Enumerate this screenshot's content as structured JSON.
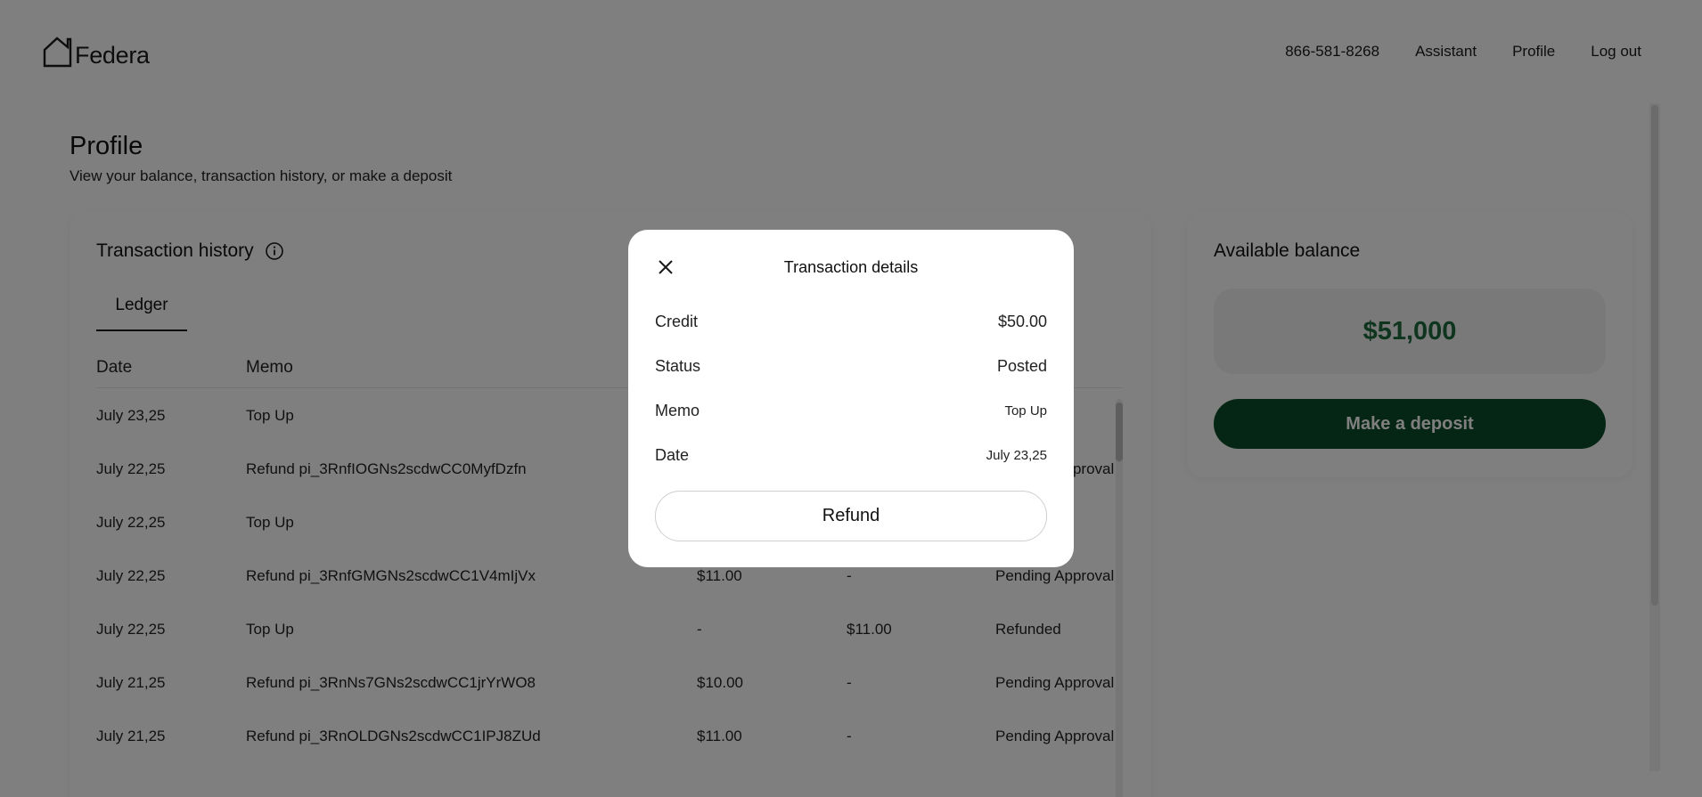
{
  "header": {
    "logo_text": "Federa",
    "nav": [
      "866-581-8268",
      "Assistant",
      "Profile",
      "Log out"
    ]
  },
  "page": {
    "title": "Profile",
    "subtitle": "View your balance, transaction history, or make a deposit"
  },
  "transactions": {
    "title": "Transaction history",
    "tab": "Ledger",
    "columns": [
      "Date",
      "Memo"
    ],
    "rows": [
      {
        "date": "July 23,25",
        "memo": "Top Up",
        "debit": "",
        "credit": "",
        "status": ""
      },
      {
        "date": "July 22,25",
        "memo": "Refund pi_3RnfIOGNs2scdwCC0MyfDzfn",
        "debit": "",
        "credit": "",
        "status": "Pending Approval"
      },
      {
        "date": "July 22,25",
        "memo": "Top Up",
        "debit": "",
        "credit": "",
        "status": ""
      },
      {
        "date": "July 22,25",
        "memo": "Refund pi_3RnfGMGNs2scdwCC1V4mIjVx",
        "debit": "$11.00",
        "credit": "-",
        "status": "Pending Approval"
      },
      {
        "date": "July 22,25",
        "memo": "Top Up",
        "debit": "-",
        "credit": "$11.00",
        "status": "Refunded"
      },
      {
        "date": "July 21,25",
        "memo": "Refund pi_3RnNs7GNs2scdwCC1jrYrWO8",
        "debit": "$10.00",
        "credit": "-",
        "status": "Pending Approval"
      },
      {
        "date": "July 21,25",
        "memo": "Refund pi_3RnOLDGNs2scdwCC1IPJ8ZUd",
        "debit": "$11.00",
        "credit": "-",
        "status": "Pending Approval"
      }
    ]
  },
  "balance": {
    "title": "Available balance",
    "amount": "$51,000",
    "deposit_label": "Make a deposit"
  },
  "modal": {
    "title": "Transaction details",
    "rows": [
      {
        "label": "Credit",
        "value": "$50.00"
      },
      {
        "label": "Status",
        "value": "Posted"
      },
      {
        "label": "Memo",
        "value": "Top Up"
      },
      {
        "label": "Date",
        "value": "July 23,25"
      }
    ],
    "refund_label": "Refund"
  },
  "colors": {
    "brand_green": "#0c4d2a",
    "balance_green": "#1f6b3e",
    "overlay": "rgba(0,0,0,0.5)"
  }
}
